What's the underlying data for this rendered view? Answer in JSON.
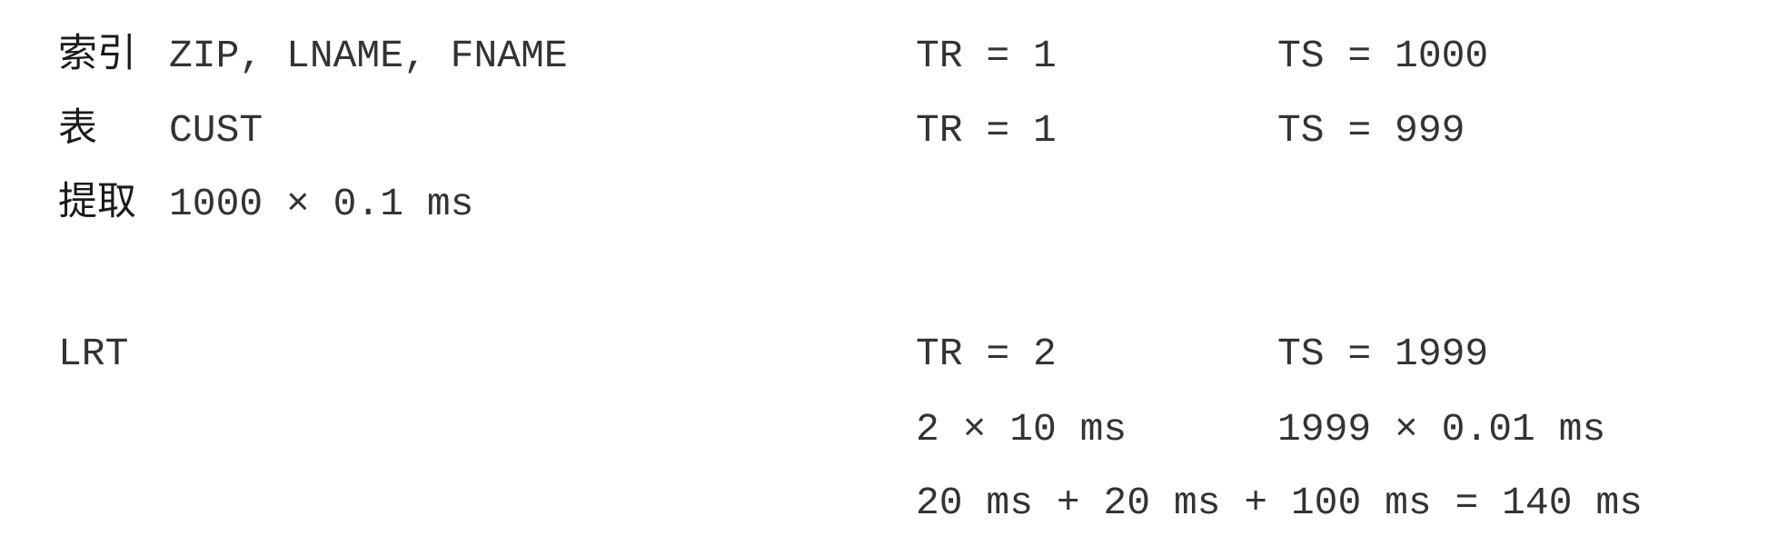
{
  "rows": {
    "index": {
      "label": "索引",
      "value": "ZIP, LNAME, FNAME",
      "tr": "TR = 1",
      "ts": "TS = 1000"
    },
    "table": {
      "label": "表",
      "value": "CUST",
      "tr": "TR = 1",
      "ts": "TS = 999"
    },
    "fetch": {
      "label": "提取",
      "value": "1000 × 0.1 ms"
    }
  },
  "lrt": {
    "label": "LRT",
    "tr": "TR = 2",
    "ts": "TS = 1999",
    "tr_time": "2 × 10 ms",
    "ts_time": "1999 × 0.01 ms",
    "total": "20 ms + 20 ms + 100 ms = 140 ms"
  }
}
